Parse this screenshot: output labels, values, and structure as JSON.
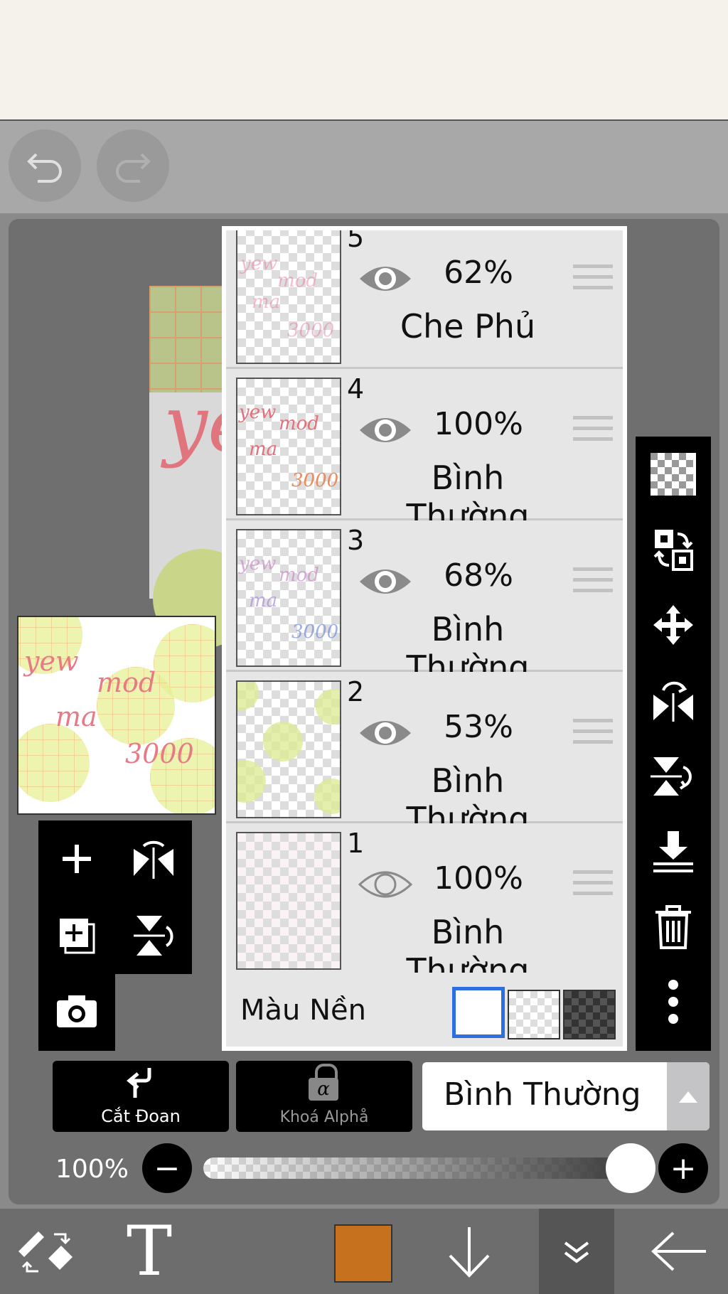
{
  "toolbar": {
    "undo_icon": "undo-icon",
    "redo_icon": "redo-icon"
  },
  "layers": [
    {
      "number": "5",
      "opacity": "62%",
      "blend": "Che Phủ",
      "visible": true
    },
    {
      "number": "4",
      "opacity": "100%",
      "blend": "Bình Thường",
      "visible": true
    },
    {
      "number": "3",
      "opacity": "68%",
      "blend": "Bình Thường",
      "visible": true
    },
    {
      "number": "2",
      "opacity": "53%",
      "blend": "Bình Thường",
      "visible": true
    },
    {
      "number": "1",
      "opacity": "100%",
      "blend": "Bình Thường",
      "visible": false
    }
  ],
  "background": {
    "label": "Màu Nền",
    "selected": "white"
  },
  "thumbnail_text": {
    "line1": "yew",
    "line2": "mod",
    "line3": "ma",
    "line4": "3000"
  },
  "buttons": {
    "clipping": "Cắt Đoan",
    "alpha_lock": "Khoá Alphå",
    "alpha_symbol": "α"
  },
  "blend_mode": {
    "value": "Bình Thường"
  },
  "opacity": {
    "label": "100%",
    "minus": "−",
    "plus": "+",
    "level": 1.0
  },
  "bottom_bar": {
    "text_tool": "T",
    "brush_color": "#c5711e"
  },
  "colors": {
    "accent_blue": "#2d6fe0",
    "panel": "#e6e6e6"
  }
}
